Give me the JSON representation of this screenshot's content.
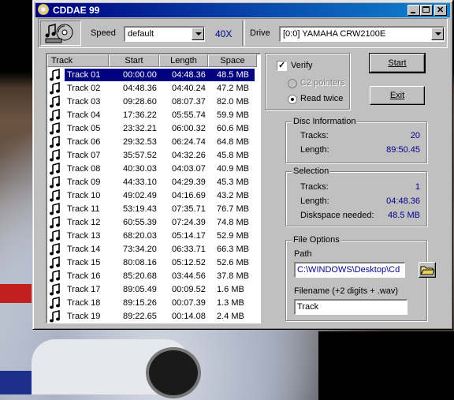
{
  "window": {
    "title": "CDDAE 99"
  },
  "toolbar": {
    "speed_label": "Speed",
    "speed_value": "default",
    "speed_readout": "40X",
    "drive_label": "Drive",
    "drive_value": "[0:0]  YAMAHA  CRW2100E"
  },
  "tracklist": {
    "columns": [
      "Track",
      "Start",
      "Length",
      "Space"
    ],
    "selected_index": 0,
    "rows": [
      {
        "track": "Track 01",
        "start": "00:00.00",
        "length": "04:48.36",
        "space": "48.5 MB"
      },
      {
        "track": "Track 02",
        "start": "04:48.36",
        "length": "04:40.24",
        "space": "47.2 MB"
      },
      {
        "track": "Track 03",
        "start": "09:28.60",
        "length": "08:07.37",
        "space": "82.0 MB"
      },
      {
        "track": "Track 04",
        "start": "17:36.22",
        "length": "05:55.74",
        "space": "59.9 MB"
      },
      {
        "track": "Track 05",
        "start": "23:32.21",
        "length": "06:00.32",
        "space": "60.6 MB"
      },
      {
        "track": "Track 06",
        "start": "29:32.53",
        "length": "06:24.74",
        "space": "64.8 MB"
      },
      {
        "track": "Track 07",
        "start": "35:57.52",
        "length": "04:32.26",
        "space": "45.8 MB"
      },
      {
        "track": "Track 08",
        "start": "40:30.03",
        "length": "04:03.07",
        "space": "40.9 MB"
      },
      {
        "track": "Track 09",
        "start": "44:33.10",
        "length": "04:29.39",
        "space": "45.3 MB"
      },
      {
        "track": "Track 10",
        "start": "49:02.49",
        "length": "04:16.69",
        "space": "43.2 MB"
      },
      {
        "track": "Track 11",
        "start": "53:19.43",
        "length": "07:35.71",
        "space": "76.7 MB"
      },
      {
        "track": "Track 12",
        "start": "60:55.39",
        "length": "07:24.39",
        "space": "74.8 MB"
      },
      {
        "track": "Track 13",
        "start": "68:20.03",
        "length": "05:14.17",
        "space": "52.9 MB"
      },
      {
        "track": "Track 14",
        "start": "73:34.20",
        "length": "06:33.71",
        "space": "66.3 MB"
      },
      {
        "track": "Track 15",
        "start": "80:08.16",
        "length": "05:12.52",
        "space": "52.6 MB"
      },
      {
        "track": "Track 16",
        "start": "85:20.68",
        "length": "03:44.56",
        "space": "37.8 MB"
      },
      {
        "track": "Track 17",
        "start": "89:05.49",
        "length": "00:09.52",
        "space": "1.6 MB"
      },
      {
        "track": "Track 18",
        "start": "89:15.26",
        "length": "00:07.39",
        "space": "1.3 MB"
      },
      {
        "track": "Track 19",
        "start": "89:22.65",
        "length": "00:14.08",
        "space": "2.4 MB"
      }
    ]
  },
  "options": {
    "verify_label": "Verify",
    "verify_checked": true,
    "c2_label": "C2 pointers",
    "read_twice_label": "Read twice",
    "start_button": "Start",
    "exit_button": "Exit"
  },
  "disc_info": {
    "heading": "Disc Information",
    "tracks_label": "Tracks:",
    "tracks_value": "20",
    "length_label": "Length:",
    "length_value": "89:50.45"
  },
  "selection": {
    "heading": "Selection",
    "tracks_label": "Tracks:",
    "tracks_value": "1",
    "length_label": "Length:",
    "length_value": "04:48.36",
    "space_label": "Diskspace needed:",
    "space_value": "48.5 MB"
  },
  "file_options": {
    "heading": "File Options",
    "path_label": "Path",
    "path_value": "C:\\WINDOWS\\Desktop\\Cd",
    "filename_label": "Filename (+2 digits + .wav)",
    "filename_value": "Track"
  },
  "colors": {
    "titlebar_start": "#000080",
    "titlebar_end": "#1084d0",
    "selection": "#000080",
    "value_text": "#00008b"
  }
}
